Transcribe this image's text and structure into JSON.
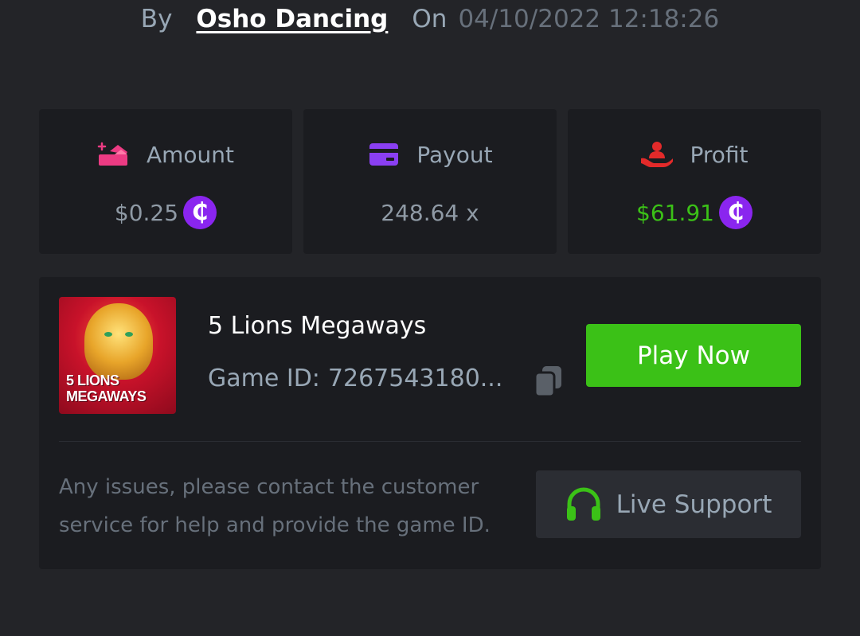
{
  "header": {
    "by_label": "By",
    "author": "Osho Dancing",
    "on_label": "On",
    "datetime": "04/10/2022 12:18:26"
  },
  "stats": {
    "amount": {
      "label": "Amount",
      "value": "$0.25",
      "icon": "amount-icon",
      "coin_symbol": "₵"
    },
    "payout": {
      "label": "Payout",
      "value": "248.64 x",
      "icon": "card-icon"
    },
    "profit": {
      "label": "Profit",
      "value": "$61.91",
      "icon": "hand-user-icon",
      "coin_symbol": "₵"
    }
  },
  "game": {
    "title": "5 Lions Megaways",
    "thumbnail_text": "5 LIONS\nMEGAWAYS",
    "id_label": "Game ID:",
    "id_value": "7267543180...",
    "play_label": "Play Now",
    "notice": "Any issues, please contact the customer service for help and provide the game ID.",
    "support_label": "Live Support"
  },
  "colors": {
    "background": "#232428",
    "card": "#1b1c20",
    "accent_green": "#3bc117",
    "coin_purple": "#8a25ef",
    "icon_pink": "#ec3b83",
    "icon_purple": "#8a3ff2",
    "icon_red": "#e32a2a",
    "muted_text": "#98a7b5"
  }
}
